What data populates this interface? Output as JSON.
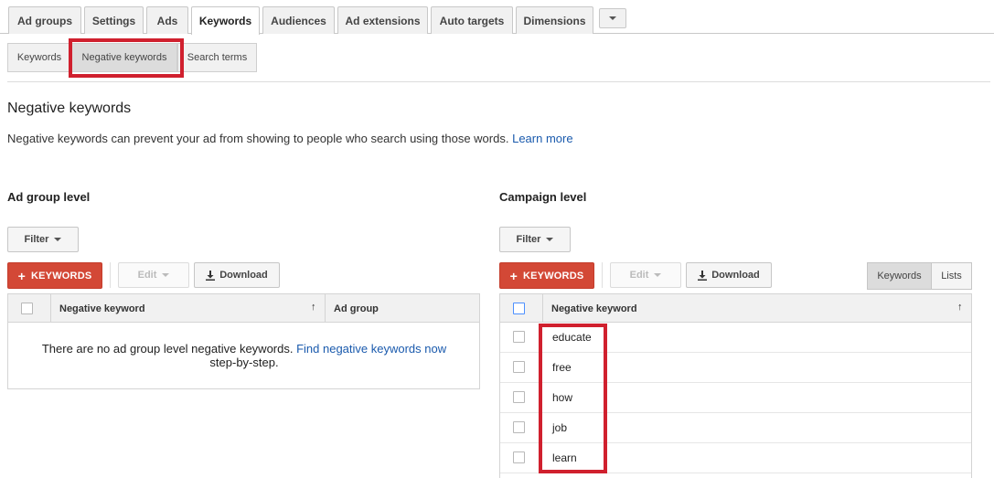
{
  "top_tabs": [
    "Ad groups",
    "Settings",
    "Ads",
    "Keywords",
    "Audiences",
    "Ad extensions",
    "Auto targets",
    "Dimensions"
  ],
  "sub_tabs": [
    "Keywords",
    "Negative keywords",
    "Search terms"
  ],
  "page": {
    "title": "Negative keywords",
    "description": "Negative keywords can prevent your ad from showing to people who search using those words.",
    "learn_more": "Learn more"
  },
  "ad_group_level": {
    "title": "Ad group level",
    "filter_label": "Filter",
    "add_label": "KEYWORDS",
    "edit_label": "Edit",
    "download_label": "Download",
    "columns": [
      "Negative keyword",
      "Ad group"
    ],
    "empty_text": "There are no ad group level negative keywords.",
    "empty_link": "Find negative keywords now",
    "empty_suffix": "step-by-step."
  },
  "campaign_level": {
    "title": "Campaign level",
    "filter_label": "Filter",
    "add_label": "KEYWORDS",
    "edit_label": "Edit",
    "download_label": "Download",
    "view_toggle": [
      "Keywords",
      "Lists"
    ],
    "columns": [
      "Negative keyword"
    ],
    "keywords": [
      "educate",
      "free",
      "how",
      "job",
      "learn"
    ]
  },
  "colors": {
    "accent_red": "#d34836",
    "highlight": "#d0202e",
    "link": "#1a5aad"
  },
  "icons": [
    "dropdown-caret-icon",
    "plus-icon",
    "download-icon",
    "sort-up-arrow-icon"
  ]
}
